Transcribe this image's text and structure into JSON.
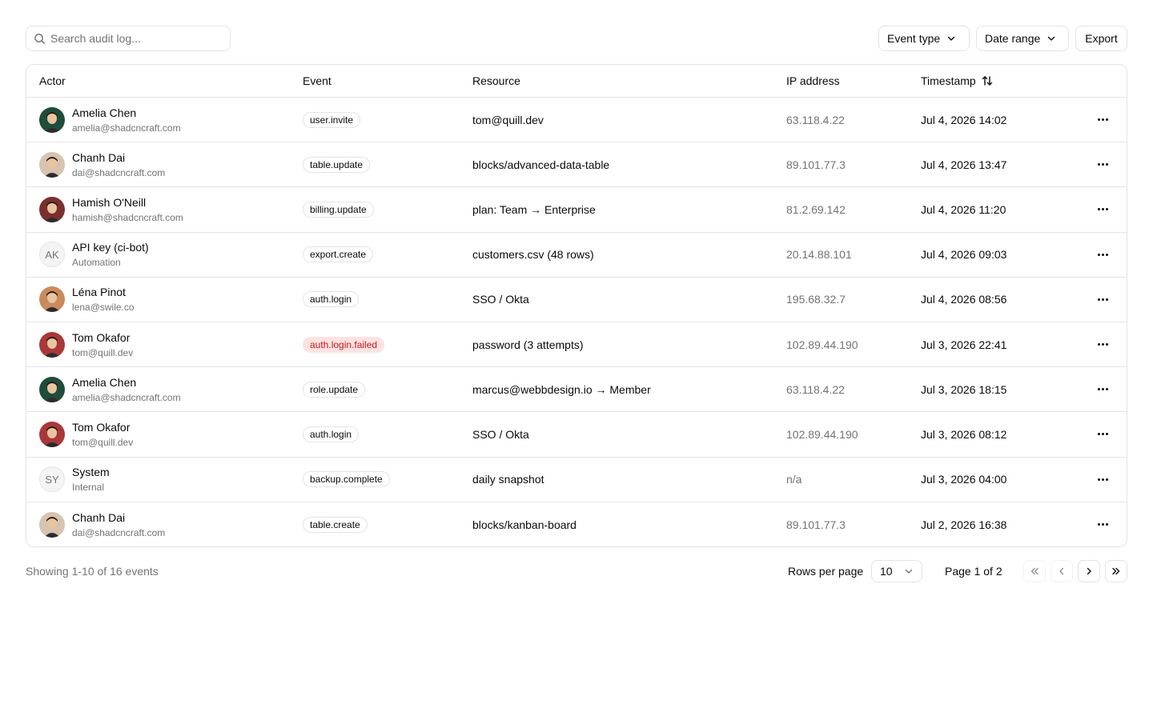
{
  "toolbar": {
    "search_placeholder": "Search audit log...",
    "event_type_label": "Event type",
    "date_range_label": "Date range",
    "export_label": "Export"
  },
  "table": {
    "headers": {
      "actor": "Actor",
      "event": "Event",
      "resource": "Resource",
      "ip": "IP address",
      "timestamp": "Timestamp"
    },
    "rows": [
      {
        "name": "Amelia Chen",
        "sub": "amelia@shadcncraft.com",
        "avatar": "photo",
        "avatar_color": "#1f4d3a",
        "event": "user.invite",
        "event_variant": "default",
        "resource": "tom@quill.dev",
        "ip": "63.118.4.22",
        "timestamp": "Jul 4, 2026 14:02"
      },
      {
        "name": "Chanh Dai",
        "sub": "dai@shadcncraft.com",
        "avatar": "photo",
        "avatar_color": "#d6c3b0",
        "event": "table.update",
        "event_variant": "default",
        "resource": "blocks/advanced-data-table",
        "ip": "89.101.77.3",
        "timestamp": "Jul 4, 2026 13:47"
      },
      {
        "name": "Hamish O'Neill",
        "sub": "hamish@shadcncraft.com",
        "avatar": "photo",
        "avatar_color": "#7a2f2f",
        "event": "billing.update",
        "event_variant": "default",
        "resource": "plan: Team → Enterprise",
        "ip": "81.2.69.142",
        "timestamp": "Jul 4, 2026 11:20"
      },
      {
        "name": "API key (ci-bot)",
        "sub": "Automation",
        "avatar": "initials",
        "initials": "AK",
        "event": "export.create",
        "event_variant": "default",
        "resource": "customers.csv (48 rows)",
        "ip": "20.14.88.101",
        "timestamp": "Jul 4, 2026 09:03"
      },
      {
        "name": "Léna Pinot",
        "sub": "lena@swile.co",
        "avatar": "photo",
        "avatar_color": "#c98a5c",
        "event": "auth.login",
        "event_variant": "default",
        "resource": "SSO / Okta",
        "ip": "195.68.32.7",
        "timestamp": "Jul 4, 2026 08:56"
      },
      {
        "name": "Tom Okafor",
        "sub": "tom@quill.dev",
        "avatar": "photo",
        "avatar_color": "#a8383a",
        "event": "auth.login.failed",
        "event_variant": "danger",
        "resource": "password (3 attempts)",
        "ip": "102.89.44.190",
        "timestamp": "Jul 3, 2026 22:41"
      },
      {
        "name": "Amelia Chen",
        "sub": "amelia@shadcncraft.com",
        "avatar": "photo",
        "avatar_color": "#1f4d3a",
        "event": "role.update",
        "event_variant": "default",
        "resource": "marcus@webbdesign.io → Member",
        "ip": "63.118.4.22",
        "timestamp": "Jul 3, 2026 18:15"
      },
      {
        "name": "Tom Okafor",
        "sub": "tom@quill.dev",
        "avatar": "photo",
        "avatar_color": "#a8383a",
        "event": "auth.login",
        "event_variant": "default",
        "resource": "SSO / Okta",
        "ip": "102.89.44.190",
        "timestamp": "Jul 3, 2026 08:12"
      },
      {
        "name": "System",
        "sub": "Internal",
        "avatar": "initials",
        "initials": "SY",
        "event": "backup.complete",
        "event_variant": "default",
        "resource": "daily snapshot",
        "ip": "n/a",
        "timestamp": "Jul 3, 2026 04:00"
      },
      {
        "name": "Chanh Dai",
        "sub": "dai@shadcncraft.com",
        "avatar": "photo",
        "avatar_color": "#d6c3b0",
        "event": "table.create",
        "event_variant": "default",
        "resource": "blocks/kanban-board",
        "ip": "89.101.77.3",
        "timestamp": "Jul 2, 2026 16:38"
      }
    ]
  },
  "footer": {
    "showing": "Showing 1-10 of 16 events",
    "rows_per_page_label": "Rows per page",
    "rows_per_page_value": "10",
    "page_info": "Page 1 of 2"
  }
}
